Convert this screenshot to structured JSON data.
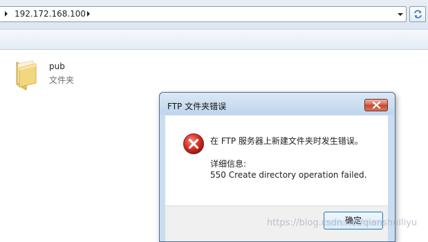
{
  "address_bar": {
    "path": "192.172.168.100"
  },
  "files": [
    {
      "name": "pub",
      "type": "文件夹"
    }
  ],
  "dialog": {
    "title": "FTP 文件夹错误",
    "message": "在 FTP 服务器上新建文件夹时发生错误。",
    "detail_label": "详细信息:",
    "detail": "550 Create directory operation failed.",
    "ok_label": "确定"
  },
  "watermark": "https://blog.csdn.net/qianshuiliyu",
  "icons": {
    "folder": "folder-icon",
    "error": "error-icon",
    "close": "close-icon",
    "refresh": "refresh-icon",
    "dropdown": "chevron-down-icon"
  },
  "colors": {
    "close_button": "#c7452f",
    "error_icon": "#c8231c",
    "dialog_frame": "#c9ddf1"
  }
}
